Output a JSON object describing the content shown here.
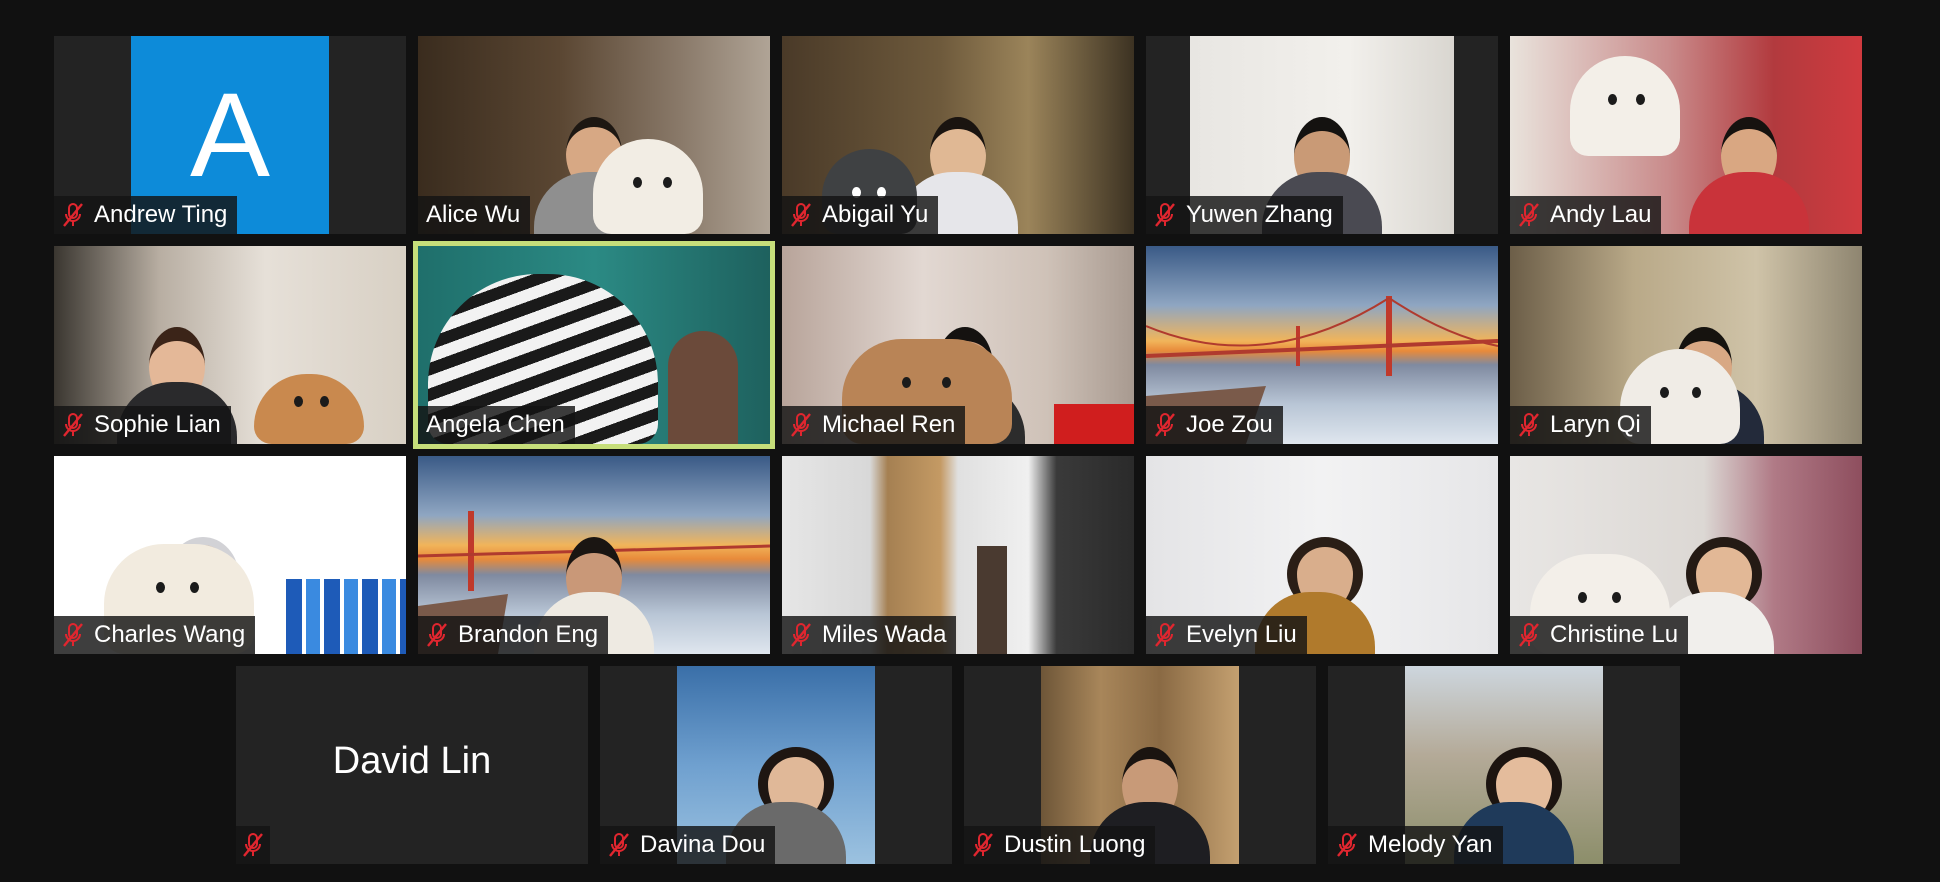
{
  "participants": [
    {
      "name": "Andrew Ting",
      "avatar_letter": "A",
      "muted": true
    },
    {
      "name": "Alice Wu",
      "muted": false
    },
    {
      "name": "Abigail Yu",
      "muted": true
    },
    {
      "name": "Yuwen Zhang",
      "muted": true
    },
    {
      "name": "Andy Lau",
      "muted": true
    },
    {
      "name": "Sophie Lian",
      "muted": true
    },
    {
      "name": "Angela Chen",
      "muted": false,
      "speaking": true
    },
    {
      "name": "Michael Ren",
      "muted": true
    },
    {
      "name": "Joe Zou",
      "muted": true
    },
    {
      "name": "Laryn Qi",
      "muted": true
    },
    {
      "name": "Charles Wang",
      "muted": true
    },
    {
      "name": "Brandon Eng",
      "muted": true
    },
    {
      "name": "Miles Wada",
      "muted": true
    },
    {
      "name": "Evelyn Liu",
      "muted": true
    },
    {
      "name": "Christine Lu",
      "muted": true
    },
    {
      "name": "David Lin",
      "muted": true,
      "video_off": true
    },
    {
      "name": "Davina Dou",
      "muted": true
    },
    {
      "name": "Dustin Luong",
      "muted": true
    },
    {
      "name": "Melody Yan",
      "muted": true
    }
  ],
  "icons": {
    "mute": "microphone-muted-icon"
  },
  "colors": {
    "background": "#111111",
    "tile": "#232323",
    "active_speaker_border": "#c6de7a",
    "mute_red": "#e0262f",
    "avatar_blue": "#0d8bd9"
  }
}
